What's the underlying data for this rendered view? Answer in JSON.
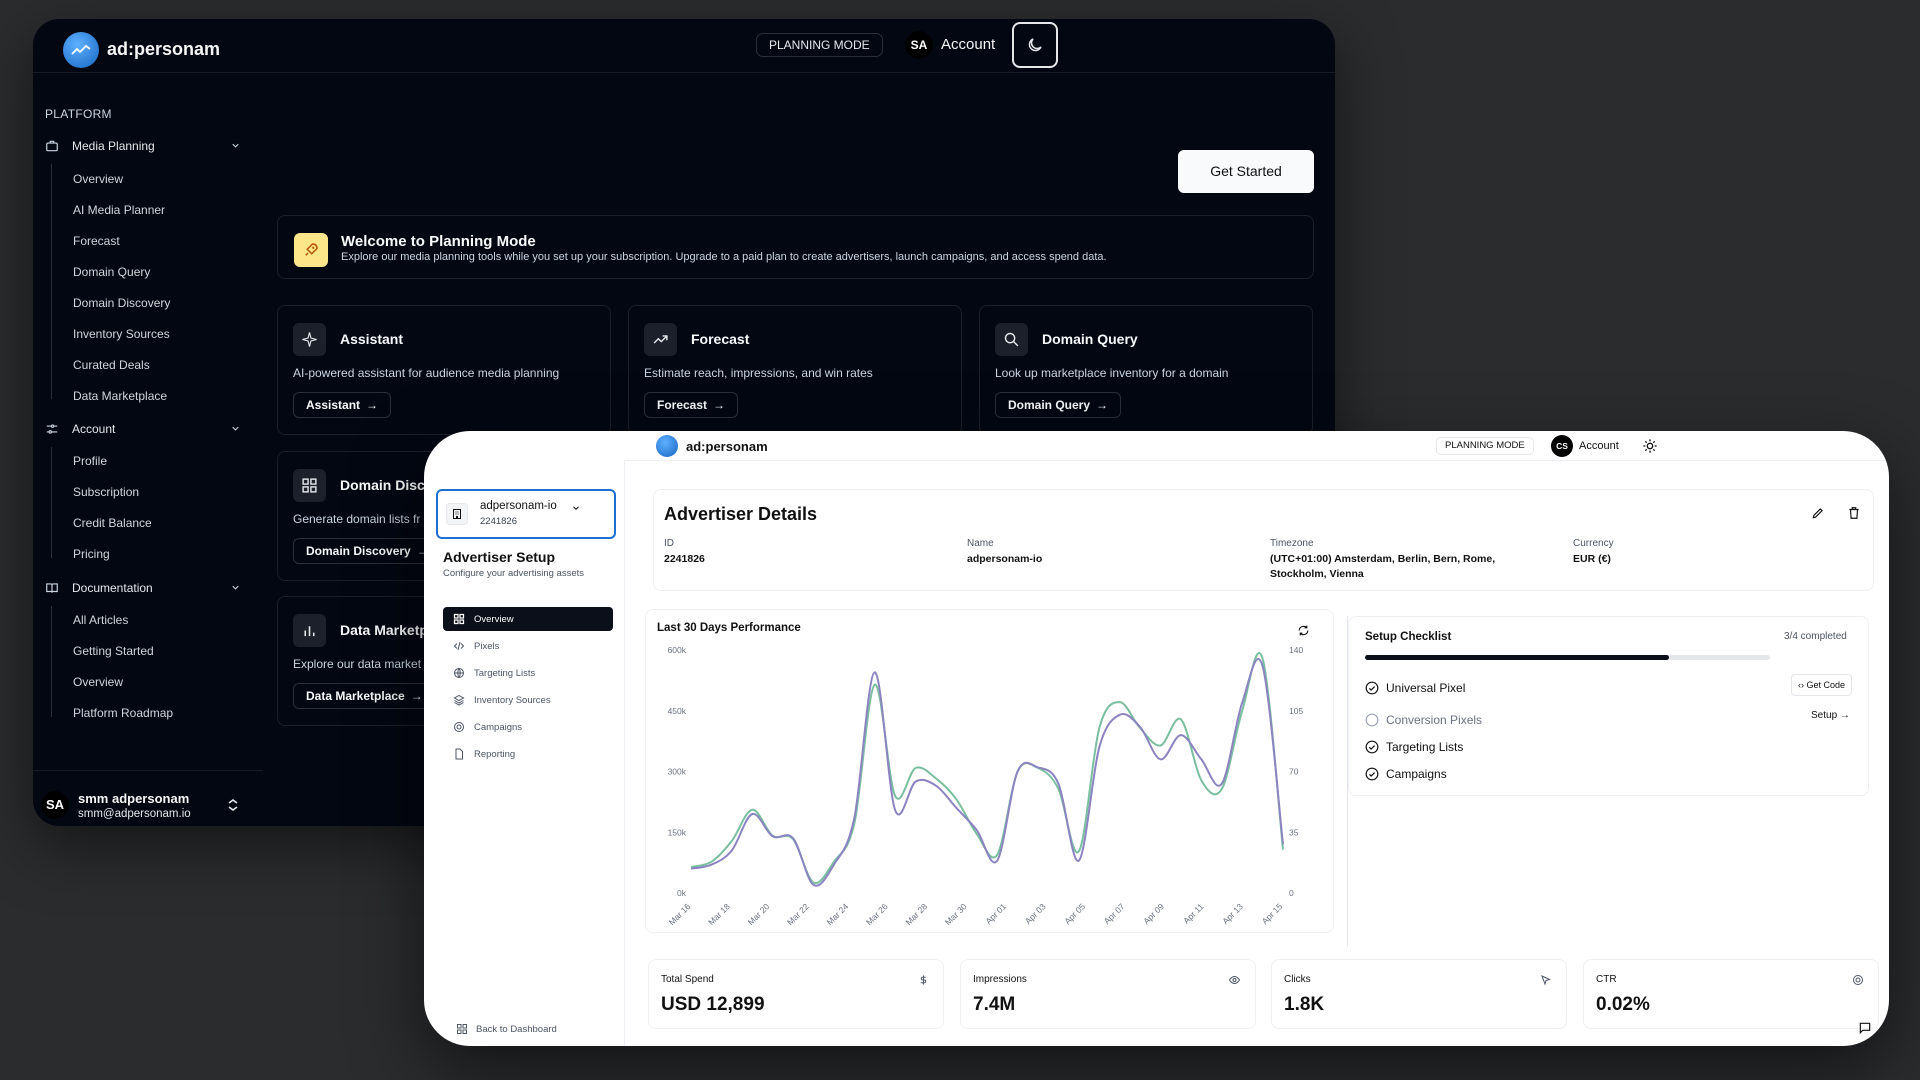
{
  "dark": {
    "brand": "ad:personam",
    "mode_badge": "PLANNING MODE",
    "account": {
      "initials": "SA",
      "label": "Account"
    },
    "theme_toggle_icon": "moon-icon",
    "sidebar": {
      "section_label": "PLATFORM",
      "groups": [
        {
          "label": "Media Planning",
          "icon": "briefcase-icon",
          "items": [
            "Overview",
            "AI Media Planner",
            "Forecast",
            "Domain Query",
            "Domain Discovery",
            "Inventory Sources",
            "Curated Deals",
            "Data Marketplace"
          ]
        },
        {
          "label": "Account",
          "icon": "sliders-icon",
          "items": [
            "Profile",
            "Subscription",
            "Credit Balance",
            "Pricing"
          ]
        },
        {
          "label": "Documentation",
          "icon": "book-icon",
          "items": [
            "All Articles",
            "Getting Started",
            "Overview",
            "Platform Roadmap"
          ]
        }
      ],
      "user": {
        "initials": "SA",
        "name": "smm adpersonam",
        "email": "smm@adpersonam.io"
      }
    },
    "get_started": "Get Started",
    "welcome": {
      "title": "Welcome to Planning Mode",
      "description": "Explore our media planning tools while you set up your subscription. Upgrade to a paid plan to create advertisers, launch campaigns, and access spend data."
    },
    "cards": [
      {
        "title": "Assistant",
        "description": "AI-powered assistant for audience media planning",
        "button": "Assistant"
      },
      {
        "title": "Forecast",
        "description": "Estimate reach, impressions, and win rates",
        "button": "Forecast"
      },
      {
        "title": "Domain Query",
        "description": "Look up marketplace inventory for a domain",
        "button": "Domain Query"
      },
      {
        "title": "Domain Disco",
        "description": "Generate domain lists fr",
        "button": "Domain Discovery"
      },
      {
        "title": "Data Marketp",
        "description": "Explore our data market",
        "button": "Data Marketplace"
      }
    ]
  },
  "light": {
    "brand": "ad:personam",
    "mode_badge": "PLANNING MODE",
    "account": {
      "initials": "CS",
      "label": "Account"
    },
    "advertiser_select": {
      "name": "adpersonam-io",
      "id": "2241826"
    },
    "sidebar": {
      "title": "Advertiser Setup",
      "subtitle": "Configure your advertising assets",
      "nav": [
        "Overview",
        "Pixels",
        "Targeting Lists",
        "Inventory Sources",
        "Campaigns",
        "Reporting"
      ],
      "active_index": 0,
      "back": "Back to Dashboard"
    },
    "details": {
      "title": "Advertiser Details",
      "fields": [
        {
          "label": "ID",
          "value": "2241826"
        },
        {
          "label": "Name",
          "value": "adpersonam-io"
        },
        {
          "label": "Timezone",
          "value": "(UTC+01:00) Amsterdam, Berlin, Bern, Rome, Stockholm, Vienna"
        },
        {
          "label": "Currency",
          "value": "EUR (€)"
        }
      ]
    },
    "checklist": {
      "title": "Setup Checklist",
      "progress_text": "3/4 completed",
      "progress": 0.75,
      "items": [
        {
          "label": "Universal Pixel",
          "done": true
        },
        {
          "label": "Conversion Pixels",
          "done": false
        },
        {
          "label": "Targeting Lists",
          "done": true
        },
        {
          "label": "Campaigns",
          "done": true
        }
      ],
      "get_code": "Get Code",
      "setup": "Setup"
    },
    "stats": [
      {
        "label": "Total Spend",
        "value": "USD 12,899",
        "icon": "dollar-icon"
      },
      {
        "label": "Impressions",
        "value": "7.4M",
        "icon": "eye-icon"
      },
      {
        "label": "Clicks",
        "value": "1.8K",
        "icon": "cursor-icon"
      },
      {
        "label": "CTR",
        "value": "0.02%",
        "icon": "target-icon"
      }
    ]
  },
  "chart_data": {
    "type": "line",
    "title": "Last 30 Days Performance",
    "x_ticks": [
      "Mar 16",
      "Mar 18",
      "Mar 20",
      "Mar 22",
      "Mar 24",
      "Mar 26",
      "Mar 28",
      "Mar 30",
      "Apr 01",
      "Apr 03",
      "Apr 05",
      "Apr 07",
      "Apr 09",
      "Apr 11",
      "Apr 13",
      "Apr 15"
    ],
    "y_left_ticks": [
      "0k",
      "150k",
      "300k",
      "450k",
      "600k"
    ],
    "y_right_ticks": [
      "0",
      "35",
      "70",
      "105",
      "140"
    ],
    "y_left_range": [
      0,
      600000
    ],
    "y_right_range": [
      0,
      140
    ],
    "grid": false,
    "series": [
      {
        "name": "",
        "axis": "left",
        "color": "#8b84c0",
        "values": [
          60000,
          70000,
          105000,
          195000,
          140000,
          135000,
          20000,
          70000,
          185000,
          545000,
          205000,
          275000,
          265000,
          210000,
          155000,
          80000,
          300000,
          310000,
          270000,
          80000,
          360000,
          440000,
          410000,
          330000,
          390000,
          330000,
          270000,
          470000,
          560000,
          120000
        ]
      },
      {
        "name": "",
        "axis": "right",
        "color": "#79bf9f",
        "values": [
          15,
          18,
          30,
          48,
          33,
          31,
          6,
          18,
          40,
          120,
          56,
          72,
          66,
          54,
          34,
          22,
          70,
          72,
          60,
          24,
          95,
          110,
          95,
          85,
          100,
          65,
          60,
          105,
          135,
          25
        ]
      }
    ]
  }
}
